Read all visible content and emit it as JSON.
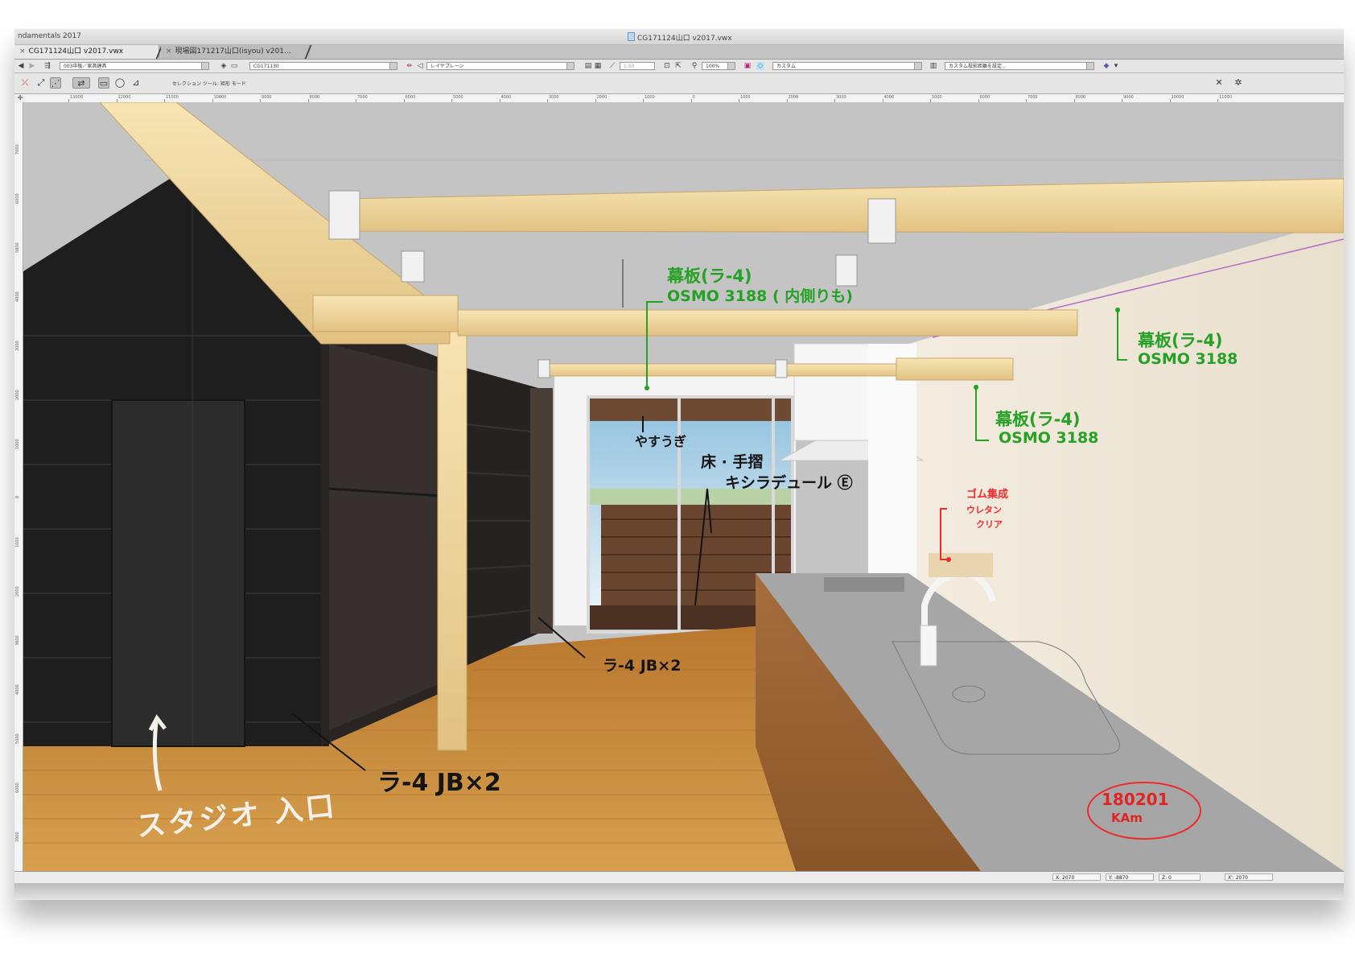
{
  "titlebar": {
    "app_title": "ndamentals 2017",
    "doc_title": "CG171124山口 v2017.vwx",
    "doc_icon": "document-icon"
  },
  "tabs": [
    {
      "label": "CG171124山口 v2017.vwx",
      "close": "×",
      "active": true
    },
    {
      "label": "現場図171217山口(isyou) v201...",
      "close": "×",
      "active": false
    }
  ],
  "toolbar1": {
    "class_combo": "003中板／家具建具",
    "viewport_combo": "CG171130",
    "layer_plane_combo": "レイヤプレーン",
    "scale_value": "1:50",
    "zoom_value": "100%",
    "render_combo": "カスタム",
    "projection_combo": "カスタム投影距離を設定..."
  },
  "toolbar2": {
    "tool_mode_label": "セレクション ツール: 矩形 モード"
  },
  "ruler": {
    "top_labels": [
      "13000",
      "12000",
      "11000",
      "10000",
      "9000",
      "8000",
      "7000",
      "6000",
      "5000",
      "4000",
      "3000",
      "2000",
      "1000",
      "0",
      "1000",
      "2000",
      "3000",
      "4000",
      "5000",
      "6000",
      "7000",
      "8000",
      "9000",
      "10000",
      "11000"
    ],
    "left_labels": [
      "7000",
      "6000",
      "5000",
      "4000",
      "3000",
      "2000",
      "1000",
      "0",
      "1000",
      "2000",
      "3000",
      "4000",
      "5000",
      "6000",
      "7000"
    ]
  },
  "annotations": {
    "ceiling_label": "幕板(ラ-4)",
    "ceiling_spec": "OSMO 3188 ( 内側りも)",
    "right_wall_label": "幕板(ラ-4)",
    "right_wall_spec": "OSMO 3188",
    "mid_label": "幕板(ラ-4)",
    "mid_spec": "OSMO 3188",
    "window_note": "やすうぎ",
    "floor_note_1": "床 · 手摺",
    "floor_note_2": "キシラデュール Ⓔ",
    "column_note": "ラ-4 JB×2",
    "wall_note": "ラ-4 JB×2",
    "counter_note_1": "ゴム集成",
    "counter_note_2": "ウレタン",
    "counter_note_3": "クリア",
    "studio_entrance": "スタジオ 入口",
    "date_stamp": "180201",
    "signature": "KAm"
  },
  "statusbar": {
    "x_label": "X: 2070",
    "y_label": "Y: -8870",
    "z_label": "Z: 0",
    "x2_label": "X': 2070"
  },
  "colors": {
    "annotation_green": "#25a125",
    "annotation_red": "#ef2a2a",
    "timber": "#f0d79e",
    "floor": "#d2953c",
    "dark_wall": "#1d1d1d"
  }
}
